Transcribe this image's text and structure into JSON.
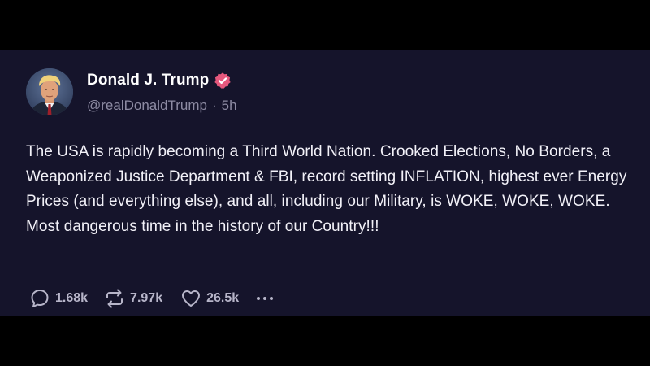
{
  "post": {
    "author": {
      "display_name": "Donald J. Trump",
      "handle": "@realDonaldTrump",
      "verified": true,
      "avatar_icon": "profile-photo"
    },
    "separator": "·",
    "timestamp": "5h",
    "text": "The USA is rapidly becoming a Third World Nation. Crooked Elections, No Borders, a Weaponized Justice Department & FBI, record setting INFLATION, highest ever Energy Prices (and everything else), and all, including our Military, is WOKE, WOKE, WOKE. Most dangerous time in the history of our Country!!!",
    "actions": {
      "replies": "1.68k",
      "reposts": "7.97k",
      "likes": "26.5k"
    }
  },
  "colors": {
    "background": "#15142b",
    "verified_badge": "#e5587d",
    "text": "#f2f1f8",
    "muted": "#8d8ba3"
  }
}
